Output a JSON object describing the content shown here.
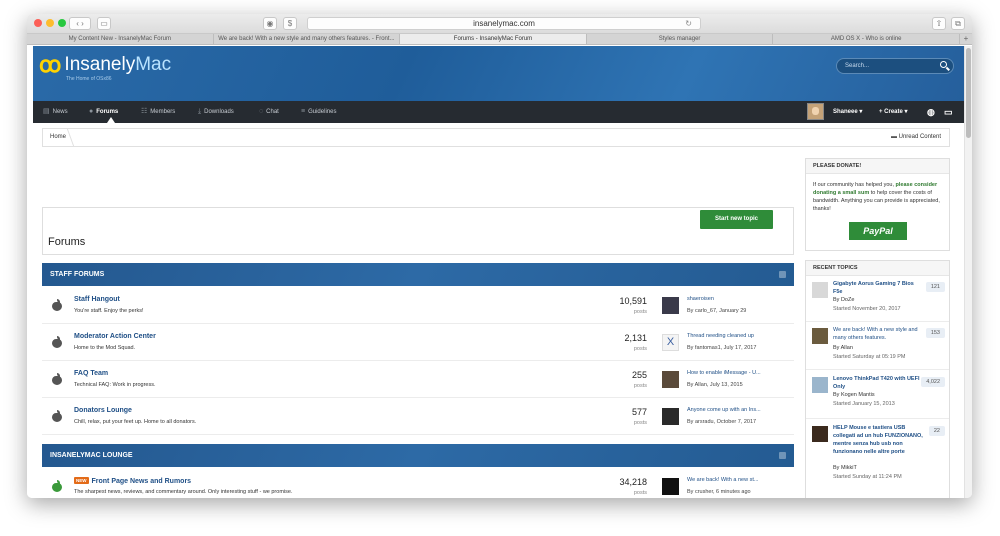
{
  "browser": {
    "url": "insanelymac.com",
    "tabs": [
      {
        "label": "My Content New - InsanelyMac Forum",
        "active": false
      },
      {
        "label": "We are back! With a new style and many others features. - Front...",
        "active": false
      },
      {
        "label": "Forums - InsanelyMac Forum",
        "active": true
      },
      {
        "label": "Styles manager",
        "active": false
      },
      {
        "label": "AMD OS X - Who is online",
        "active": false
      }
    ],
    "new_tab": "+"
  },
  "header": {
    "logo_name": "InsanelyMac",
    "logo_part1": "Insanely",
    "logo_part2": "Mac",
    "tagline": "The Home of OSx86",
    "search_placeholder": "Search..."
  },
  "nav": {
    "items": [
      {
        "label": "News",
        "icon": "newspaper-icon"
      },
      {
        "label": "Forums",
        "icon": "comments-icon"
      },
      {
        "label": "Members",
        "icon": "users-icon"
      },
      {
        "label": "Downloads",
        "icon": "download-icon"
      },
      {
        "label": "Chat",
        "icon": "chat-icon"
      },
      {
        "label": "Guidelines",
        "icon": "list-icon"
      }
    ],
    "active": "Forums",
    "user": "Shaneee ▾",
    "create": "+ Create ▾"
  },
  "breadcrumb": {
    "home": "Home",
    "unread": "Unread Content"
  },
  "main": {
    "title": "Forums",
    "start_topic": "Start new topic"
  },
  "categories": [
    {
      "name": "STAFF FORUMS",
      "forums": [
        {
          "title": "Staff Hangout",
          "desc": "You're staff. Enjoy the perks!",
          "count": "10,591",
          "posts": "posts",
          "last": "shaeroisen",
          "by": "By carlo_67, January 29"
        },
        {
          "title": "Moderator Action Center",
          "desc": "Home to the Mod Squad.",
          "count": "2,131",
          "posts": "posts",
          "last": "Thread needing cleaned up",
          "by": "By fantomas1, July 17, 2017"
        },
        {
          "title": "FAQ Team",
          "desc": "Technical FAQ: Work in progress.",
          "count": "255",
          "posts": "posts",
          "last": "How to enable iMessage - U...",
          "by": "By Allan, July 13, 2015"
        },
        {
          "title": "Donators Lounge",
          "desc": "Chill, relax, put your feet up. Home to all donators.",
          "count": "577",
          "posts": "posts",
          "last": "Anyone come up with an Ins...",
          "by": "By arsradu, October 7, 2017"
        }
      ]
    },
    {
      "name": "INSANELYMAC LOUNGE",
      "forums": [
        {
          "badge": "NEW",
          "title": "Front Page News and Rumors",
          "desc": "The sharpest news, reviews, and commentary around. Only interesting stuff - we promise.",
          "count": "34,218",
          "posts": "posts",
          "last": "We are back! With a new st...",
          "by": "By crusher, 6 minutes ago"
        }
      ]
    }
  ],
  "sidebar": {
    "donate": {
      "heading": "PLEASE DONATE!",
      "text_1": "If our community has helped you, ",
      "text_bold": "please consider donating a small sum",
      "text_2": " to help cover the costs of bandwidth. Anything you can provide is appreciated, thanks!",
      "paypal": "PayPal"
    },
    "recent": {
      "heading": "RECENT TOPICS",
      "topics": [
        {
          "title": "Gigabyte Aorus Gaming 7 Bios F5e",
          "by": "By DoZe",
          "started": "Started November 20, 2017",
          "count": "121"
        },
        {
          "title": "We are back! With a new style and many others features.",
          "by": "By Allan",
          "started": "Started Saturday at 05:19 PM",
          "count": "153"
        },
        {
          "title": "Lenovo ThinkPad T420 with UEFI Only",
          "by": "By Kogen Mantis",
          "started": "Started January 15, 2013",
          "count": "4,022"
        },
        {
          "title": "HELP Mouse e tastiera USB collegati ad un hub FUNZIONANO, mentre senza hub usb non funzionano nelle altre porte",
          "by": "By MikkiT",
          "started": "Started Sunday at 11:24 PM",
          "count": "22"
        }
      ]
    }
  },
  "colors": {
    "header_blue": "#2a6aa8",
    "nav_dark": "#262b31",
    "button_green": "#2f8c39",
    "link_blue": "#1f4f86"
  }
}
